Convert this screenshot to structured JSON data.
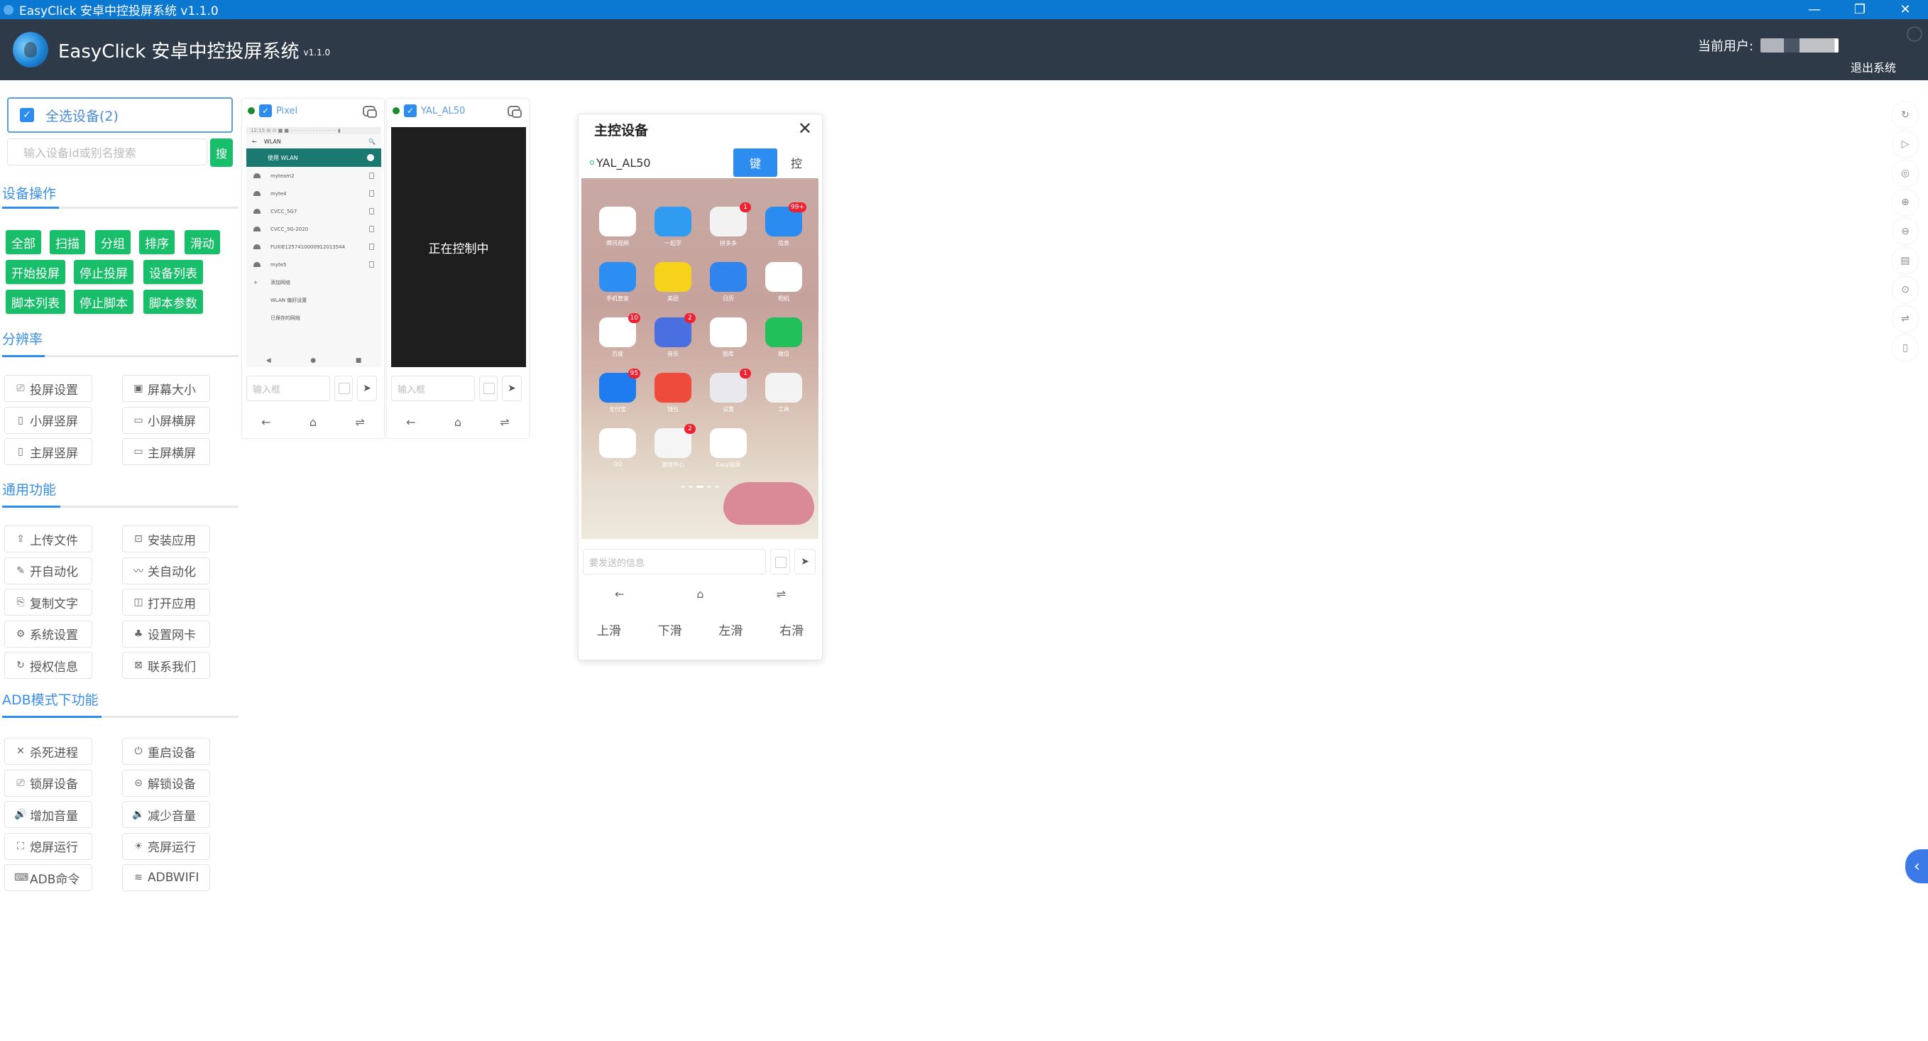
{
  "window": {
    "title": "EasyClick 安卓中控投屏系统 v1.1.0",
    "controls": {
      "minimize": "—",
      "restore": "❐",
      "close": "✕"
    }
  },
  "header": {
    "app_name": "EasyClick 安卓中控投屏系统",
    "version": "v1.1.0",
    "current_user_label": "当前用户:",
    "logout_label": "退出系统"
  },
  "sidebar": {
    "select_all_label": "全选设备(2)",
    "search_placeholder": "输入设备id或别名搜索",
    "search_button": "搜",
    "sections": {
      "device_ops": {
        "title": "设备操作",
        "buttons": [
          "全部",
          "扫描",
          "分组",
          "排序",
          "滑动",
          "开始投屏",
          "停止投屏",
          "设备列表",
          "脚本列表",
          "停止脚本",
          "脚本参数"
        ]
      },
      "resolution": {
        "title": "分辨率",
        "buttons": [
          {
            "label": "投屏设置",
            "icon": "monitor-settings-icon",
            "glyph": "⎚"
          },
          {
            "label": "屏幕大小",
            "icon": "screen-size-icon",
            "glyph": "▣"
          },
          {
            "label": "小屏竖屏",
            "icon": "portrait-icon",
            "glyph": "▯"
          },
          {
            "label": "小屏横屏",
            "icon": "landscape-icon",
            "glyph": "▭"
          },
          {
            "label": "主屏竖屏",
            "icon": "portrait-icon",
            "glyph": "▯"
          },
          {
            "label": "主屏横屏",
            "icon": "landscape-icon",
            "glyph": "▭"
          }
        ]
      },
      "general": {
        "title": "通用功能",
        "buttons": [
          {
            "label": "上传文件",
            "icon": "upload-icon",
            "glyph": "⇪"
          },
          {
            "label": "安装应用",
            "icon": "install-icon",
            "glyph": "⊡"
          },
          {
            "label": "开自动化",
            "icon": "edit-icon",
            "glyph": "✎"
          },
          {
            "label": "关自动化",
            "icon": "wave-icon",
            "glyph": "〰"
          },
          {
            "label": "复制文字",
            "icon": "copy-doc-icon",
            "glyph": "⎘"
          },
          {
            "label": "打开应用",
            "icon": "book-icon",
            "glyph": "◫"
          },
          {
            "label": "系统设置",
            "icon": "settings-icon",
            "glyph": "⚙"
          },
          {
            "label": "设置网卡",
            "icon": "network-icon",
            "glyph": "♣"
          },
          {
            "label": "授权信息",
            "icon": "refresh-icon",
            "glyph": "↻"
          },
          {
            "label": "联系我们",
            "icon": "contact-icon",
            "glyph": "⊠"
          }
        ]
      },
      "adb": {
        "title": "ADB模式下功能",
        "buttons": [
          {
            "label": "杀死进程",
            "icon": "close-icon",
            "glyph": "✕"
          },
          {
            "label": "重启设备",
            "icon": "power-icon",
            "glyph": "⏻"
          },
          {
            "label": "锁屏设备",
            "icon": "lock-screen-icon",
            "glyph": "⎚"
          },
          {
            "label": "解锁设备",
            "icon": "unlock-icon",
            "glyph": "⊝"
          },
          {
            "label": "增加音量",
            "icon": "volume-up-icon",
            "glyph": "🔊"
          },
          {
            "label": "减少音量",
            "icon": "volume-down-icon",
            "glyph": "🔉"
          },
          {
            "label": "熄屏运行",
            "icon": "screen-off-icon",
            "glyph": "⛶"
          },
          {
            "label": "亮屏运行",
            "icon": "screen-on-icon",
            "glyph": "☀"
          },
          {
            "label": "ADB命令",
            "icon": "terminal-icon",
            "glyph": "⌨"
          },
          {
            "label": "ADBWIFI",
            "icon": "wifi-icon",
            "glyph": "≋"
          }
        ]
      }
    }
  },
  "devices": [
    {
      "name": "Pixel",
      "checked": true,
      "status_color": "#1a8a2a",
      "input_placeholder": "输入框",
      "screen": {
        "title": "WLAN",
        "toggle_label": "使用 WLAN",
        "networks": [
          "myteam2",
          "myte4",
          "CVCC_5G7",
          "CVCC_5G-2020",
          "FUXIE1257410000912013544",
          "myte5"
        ],
        "add_label": "添加网络",
        "prefs": [
          "WLAN 偏好设置",
          "已保存的网络"
        ]
      }
    },
    {
      "name": "YAL_AL50",
      "checked": true,
      "status_color": "#1a8a2a",
      "input_placeholder": "输入框",
      "screen_message": "正在控制中"
    }
  ],
  "master_device": {
    "title": "主控设备",
    "device_name": "YAL_AL50",
    "tab_keyboard": "键",
    "tab_control": "控",
    "input_placeholder": "要发送的信息",
    "swipes": [
      "上滑",
      "下滑",
      "左滑",
      "右滑"
    ],
    "apps": [
      {
        "name": "腾讯视频",
        "color": "#ffffff",
        "badge": ""
      },
      {
        "name": "一起学",
        "color": "#2f9cf2",
        "badge": ""
      },
      {
        "name": "拼多多",
        "color": "#f2f2f2",
        "badge": "1"
      },
      {
        "name": "信息",
        "color": "#2a8cf0",
        "badge": "99+"
      },
      {
        "name": "手机管家",
        "color": "#2c8ef2",
        "badge": ""
      },
      {
        "name": "美团",
        "color": "#f7d21a",
        "badge": ""
      },
      {
        "name": "日历",
        "color": "#2f84ee",
        "badge": ""
      },
      {
        "name": "相机",
        "color": "#ffffff",
        "badge": ""
      },
      {
        "name": "百度",
        "color": "#ffffff",
        "badge": "10"
      },
      {
        "name": "音乐",
        "color": "#4a6fe0",
        "badge": "2"
      },
      {
        "name": "图库",
        "color": "#ffffff",
        "badge": ""
      },
      {
        "name": "微信",
        "color": "#21c05a",
        "badge": ""
      },
      {
        "name": "支付宝",
        "color": "#1e7bf0",
        "badge": "95"
      },
      {
        "name": "钱包",
        "color": "#ef4b3c",
        "badge": ""
      },
      {
        "name": "设置",
        "color": "#e8e8ee",
        "badge": "1"
      },
      {
        "name": "工具",
        "color": "#f3f3f3",
        "badge": ""
      },
      {
        "name": "QQ",
        "color": "#ffffff",
        "badge": ""
      },
      {
        "name": "游戏中心",
        "color": "#f5f5f5",
        "badge": "2"
      },
      {
        "name": "Easy投屏",
        "color": "#ffffff",
        "badge": ""
      }
    ]
  },
  "right_toolbar": [
    {
      "icon": "refresh-icon",
      "glyph": "↻"
    },
    {
      "icon": "play-icon",
      "glyph": "▷"
    },
    {
      "icon": "stop-icon",
      "glyph": "◎"
    },
    {
      "icon": "zoom-in-icon",
      "glyph": "⊕"
    },
    {
      "icon": "zoom-out-icon",
      "glyph": "⊖"
    },
    {
      "icon": "layout-icon",
      "glyph": "▤"
    },
    {
      "icon": "toggle-icon",
      "glyph": "⊙"
    },
    {
      "icon": "filter-icon",
      "glyph": "⇌"
    },
    {
      "icon": "tablet-icon",
      "glyph": "▯"
    }
  ],
  "collapse_glyph": "‹",
  "nav": {
    "back": "←",
    "home": "⌂",
    "menu": "⇌"
  },
  "colors": {
    "accent": "#2d8cf0",
    "green": "#19be6b",
    "header": "#2f3a48",
    "titlebar": "#0b78d2"
  }
}
